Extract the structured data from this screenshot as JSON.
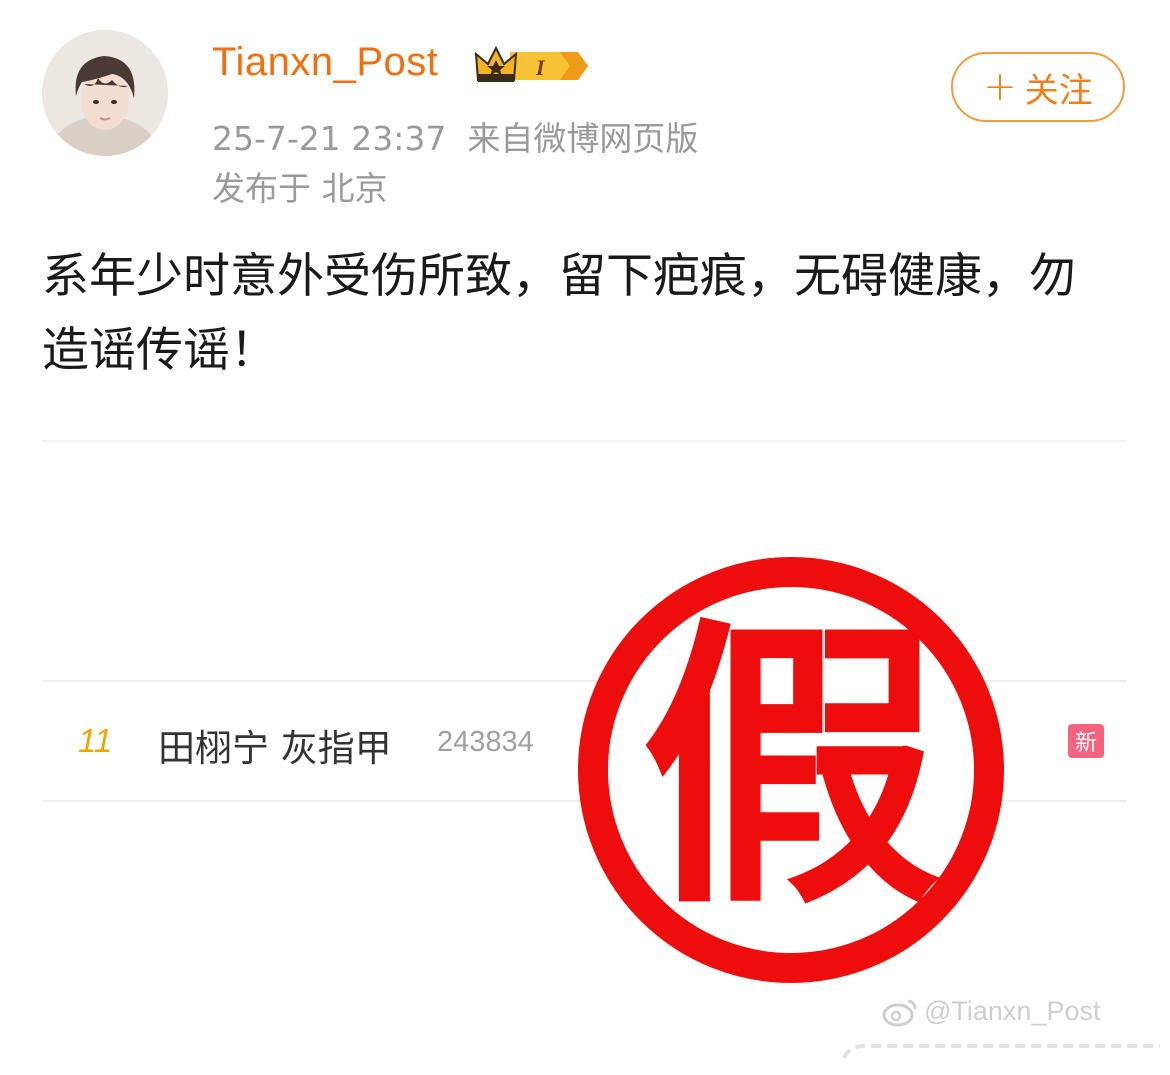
{
  "post": {
    "username": "Tianxn_Post",
    "vip_level": "I",
    "timestamp": "25-7-21 23:37",
    "source": "来自微博网页版",
    "location": "发布于 北京",
    "follow_label": "关注",
    "text": "系年少时意外受伤所致，留下疤痕，无碍健康，勿造谣传谣！"
  },
  "image": {
    "hot_rank": "11",
    "hot_title": "田栩宁 灰指甲",
    "hot_count": "243834",
    "new_badge": "新",
    "stamp_text": "假",
    "watermark": "@Tianxn_Post"
  },
  "colors": {
    "username": "#f26e0e",
    "follow_border": "#f59a3a",
    "stamp_red": "#ee0d0d",
    "rank_gold": "#f0a500",
    "new_badge_pink": "#f5637f"
  },
  "icons": [
    "avatar-photo",
    "crown-vip-icon",
    "plus-icon",
    "weibo-logo-icon"
  ]
}
